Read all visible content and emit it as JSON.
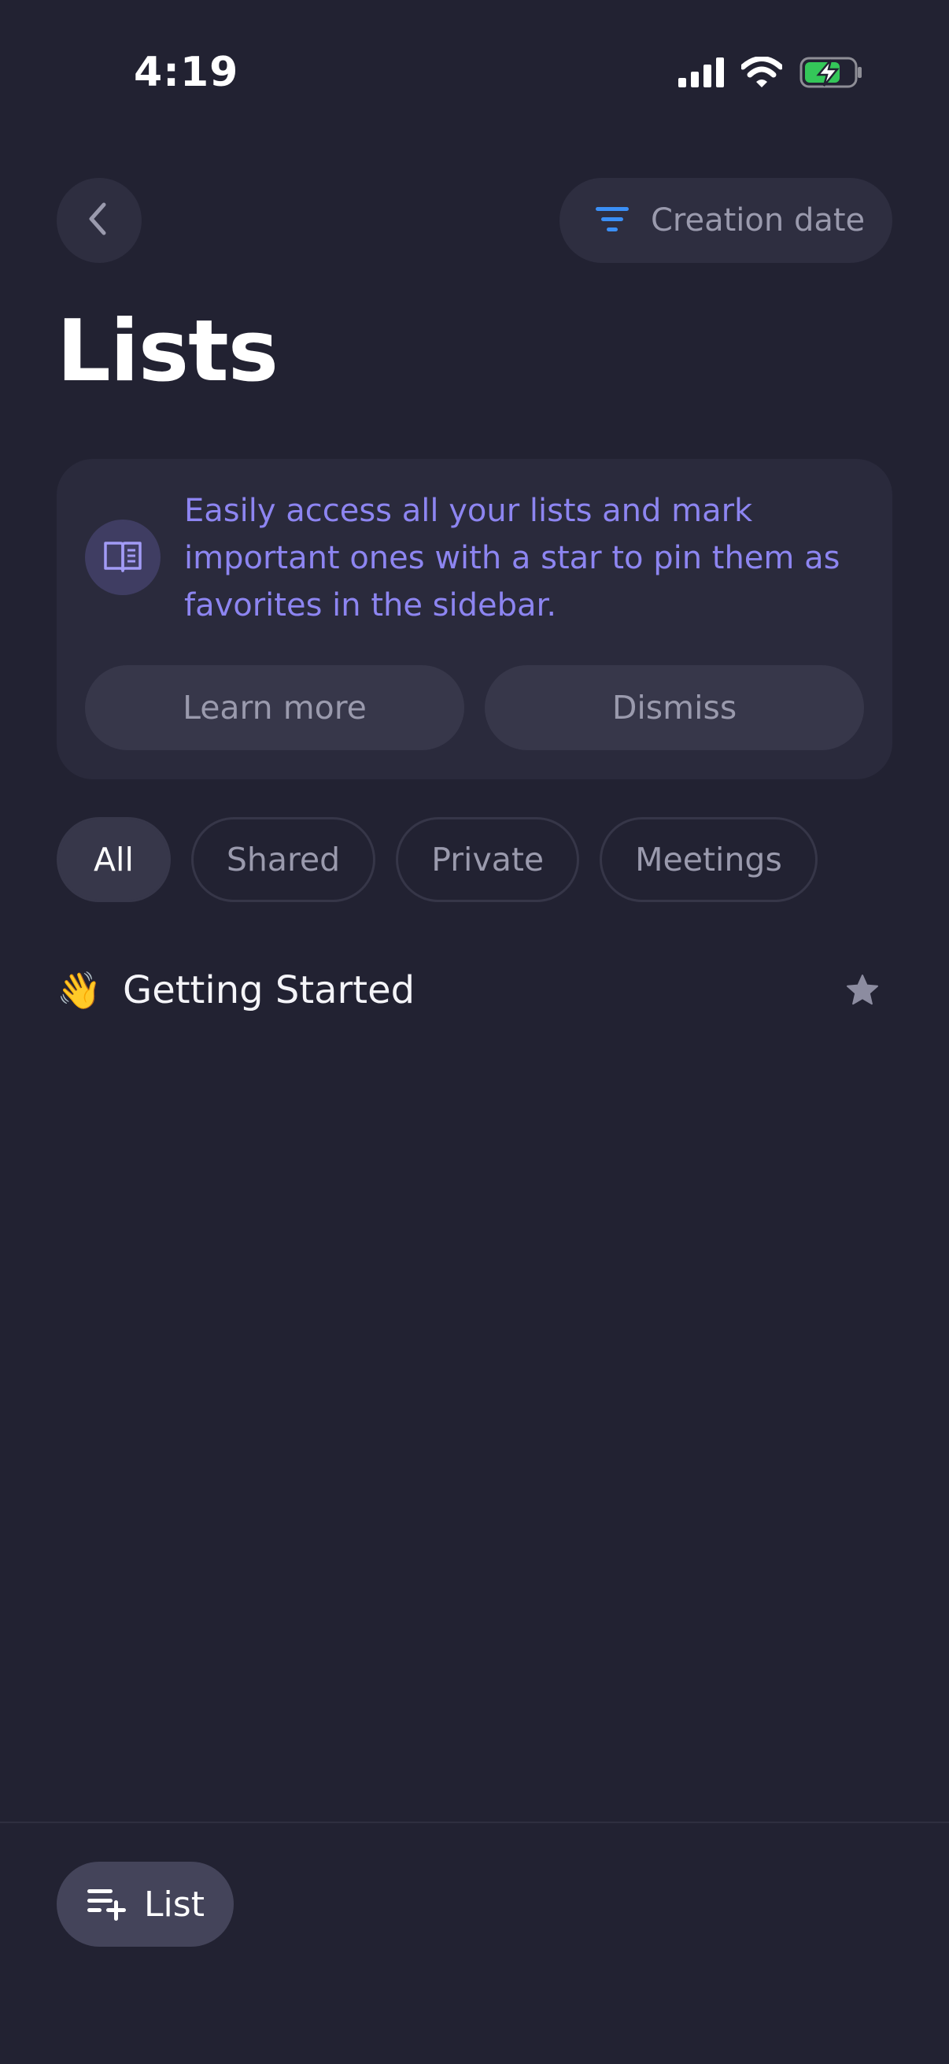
{
  "status_bar": {
    "time": "4:19",
    "icons": [
      "cellular-signal-icon",
      "wifi-icon",
      "battery-charging-icon"
    ],
    "battery_color": "#34c759"
  },
  "header": {
    "back_icon": "chevron-left-icon",
    "sort_icon": "filter-lines-icon",
    "sort_label": "Creation date",
    "sort_icon_color": "#3b8ff6"
  },
  "page": {
    "title": "Lists"
  },
  "info_card": {
    "icon": "open-book-icon",
    "text": "Easily access all your lists and mark important ones with a star to pin them as favorites in the sidebar.",
    "learn_more_label": "Learn more",
    "dismiss_label": "Dismiss",
    "accent_color": "#8d85f1"
  },
  "filters": [
    {
      "label": "All",
      "active": true
    },
    {
      "label": "Shared",
      "active": false
    },
    {
      "label": "Private",
      "active": false
    },
    {
      "label": "Meetings",
      "active": false
    }
  ],
  "lists": [
    {
      "emoji": "👋",
      "title": "Getting Started",
      "starred": true,
      "star_icon": "star-icon"
    }
  ],
  "footer": {
    "new_list_icon": "list-add-icon",
    "new_list_label": "List"
  }
}
